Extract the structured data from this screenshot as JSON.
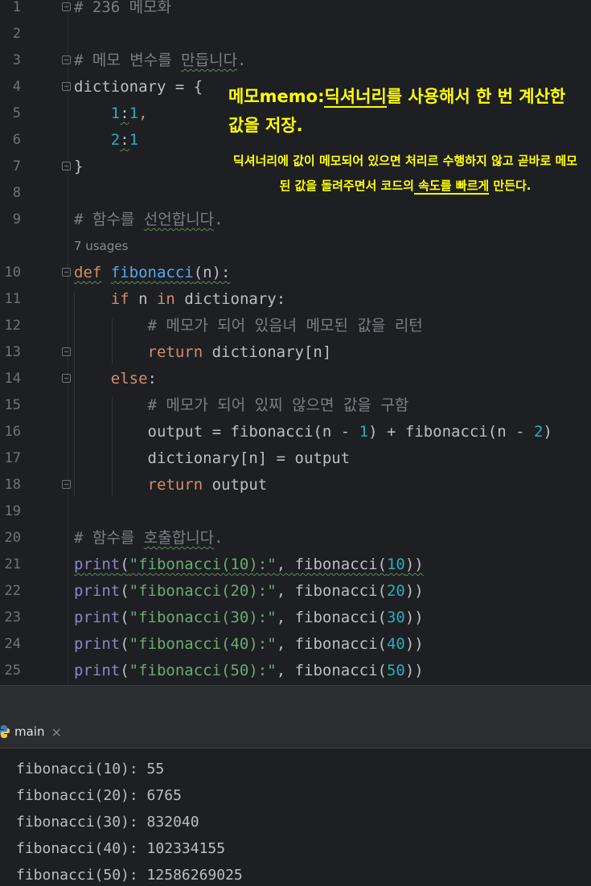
{
  "editor": {
    "lines": [
      {
        "n": "1",
        "parts": [
          [
            "# 236 메모화",
            "c-comment"
          ]
        ]
      },
      {
        "n": "2",
        "parts": []
      },
      {
        "n": "3",
        "parts": [
          [
            "# 메모 변수를 ",
            "c-comment"
          ],
          [
            "만듭니다",
            "c-comment squig"
          ],
          [
            ".",
            "c-comment"
          ]
        ]
      },
      {
        "n": "4",
        "parts": [
          [
            "dictionary",
            ""
          ],
          [
            " = {",
            ""
          ]
        ]
      },
      {
        "n": "5",
        "parts": [
          [
            "    ",
            ""
          ],
          [
            "1",
            "c-num"
          ],
          [
            ":",
            "squig"
          ],
          [
            "1",
            "c-num"
          ],
          [
            ",",
            "c-kw"
          ]
        ]
      },
      {
        "n": "6",
        "parts": [
          [
            "    ",
            ""
          ],
          [
            "2",
            "c-num"
          ],
          [
            ":",
            "squig"
          ],
          [
            "1",
            "c-num"
          ]
        ]
      },
      {
        "n": "7",
        "parts": [
          [
            "}",
            ""
          ]
        ]
      },
      {
        "n": "8",
        "parts": []
      },
      {
        "n": "9",
        "parts": [
          [
            "# 함수를 ",
            "c-comment"
          ],
          [
            "선언합니다",
            "c-comment squig"
          ],
          [
            ".",
            "c-comment"
          ]
        ]
      },
      {
        "n": "10",
        "parts": [
          [
            "def",
            "c-kw squig"
          ],
          [
            " ",
            ""
          ],
          [
            "fibonacci",
            "c-defn squig"
          ],
          [
            "(n):",
            "squig"
          ]
        ]
      },
      {
        "n": "11",
        "parts": [
          [
            "    ",
            ""
          ],
          [
            "if",
            "c-kw"
          ],
          [
            " n ",
            ""
          ],
          [
            "in",
            "c-kw"
          ],
          [
            " dictionary:",
            ""
          ]
        ]
      },
      {
        "n": "12",
        "parts": [
          [
            "        ",
            ""
          ],
          [
            "# 메모가 되어 있음녀 메모된 값을 리턴",
            "c-comment"
          ]
        ]
      },
      {
        "n": "13",
        "parts": [
          [
            "        ",
            ""
          ],
          [
            "return",
            "c-kw"
          ],
          [
            " dictionary[n]",
            ""
          ]
        ]
      },
      {
        "n": "14",
        "parts": [
          [
            "    ",
            ""
          ],
          [
            "else",
            "c-kw"
          ],
          [
            ":",
            ""
          ]
        ]
      },
      {
        "n": "15",
        "parts": [
          [
            "        ",
            ""
          ],
          [
            "# 메모가 되어 있찌 않으면 값을 구함",
            "c-comment"
          ]
        ]
      },
      {
        "n": "16",
        "parts": [
          [
            "        ",
            ""
          ],
          [
            "output = fibonacci(n - ",
            ""
          ],
          [
            "1",
            "c-num"
          ],
          [
            ") + fibonacci(n - ",
            ""
          ],
          [
            "2",
            "c-num"
          ],
          [
            ")",
            ""
          ]
        ]
      },
      {
        "n": "17",
        "parts": [
          [
            "        ",
            ""
          ],
          [
            "dictionary[n] = output",
            ""
          ]
        ]
      },
      {
        "n": "18",
        "parts": [
          [
            "        ",
            ""
          ],
          [
            "return",
            "c-kw"
          ],
          [
            " output",
            ""
          ]
        ]
      },
      {
        "n": "19",
        "parts": []
      },
      {
        "n": "20",
        "parts": [
          [
            "# 함수를 ",
            "c-comment"
          ],
          [
            "호출합니다",
            "c-comment squig"
          ],
          [
            ".",
            "c-comment"
          ]
        ]
      },
      {
        "n": "21",
        "parts": [
          [
            "print",
            "c-builtin squig"
          ],
          [
            "(",
            "squig"
          ],
          [
            "\"fibonacci(10):\"",
            "c-str squig"
          ],
          [
            ", fibonacci(",
            "squig"
          ],
          [
            "10",
            "c-num squig"
          ],
          [
            "))",
            "squig"
          ]
        ]
      },
      {
        "n": "22",
        "parts": [
          [
            "print",
            "c-builtin"
          ],
          [
            "(",
            ""
          ],
          [
            "\"fibonacci(20):\"",
            "c-str"
          ],
          [
            ", fibonacci(",
            ""
          ],
          [
            "20",
            "c-num"
          ],
          [
            "))",
            ""
          ]
        ]
      },
      {
        "n": "23",
        "parts": [
          [
            "print",
            "c-builtin"
          ],
          [
            "(",
            ""
          ],
          [
            "\"fibonacci(30):\"",
            "c-str"
          ],
          [
            ", fibonacci(",
            ""
          ],
          [
            "30",
            "c-num"
          ],
          [
            "))",
            ""
          ]
        ]
      },
      {
        "n": "24",
        "parts": [
          [
            "print",
            "c-builtin"
          ],
          [
            "(",
            ""
          ],
          [
            "\"fibonacci(40):\"",
            "c-str"
          ],
          [
            ", fibonacci(",
            ""
          ],
          [
            "40",
            "c-num"
          ],
          [
            "))",
            ""
          ]
        ]
      },
      {
        "n": "25",
        "parts": [
          [
            "print",
            "c-builtin"
          ],
          [
            "(",
            ""
          ],
          [
            "\"fibonacci(50):\"",
            "c-str"
          ],
          [
            ", fibonacci(",
            ""
          ],
          [
            "50",
            "c-num"
          ],
          [
            "))",
            ""
          ]
        ]
      }
    ],
    "usages_hint": "7 usages"
  },
  "annotation": {
    "title_a": "메모memo:",
    "title_b": "딕셔너리",
    "title_c": "를 사용해서 한 번 계산한 값을 저장.",
    "body_a": "딕셔너리에 값이 메모되어 있으면 처리르 수행하지 않고 곧바로 메모된 값을 돌려주면서 코드의",
    "body_b": " 속도를 빠르게",
    "body_c": " 만든다."
  },
  "run": {
    "tab_label": "main",
    "close_icon": "×",
    "output": [
      "fibonacci(10): 55",
      "fibonacci(20): 6765",
      "fibonacci(30): 832040",
      "fibonacci(40): 102334155",
      "fibonacci(50): 12586269025"
    ]
  },
  "colors": {
    "background": "#1e1f22",
    "keyword": "#cf8e6d",
    "string": "#6aab73",
    "number": "#2aacb8",
    "comment": "#7a7e85",
    "builtin": "#8888c6",
    "annotation": "#ffff00"
  }
}
